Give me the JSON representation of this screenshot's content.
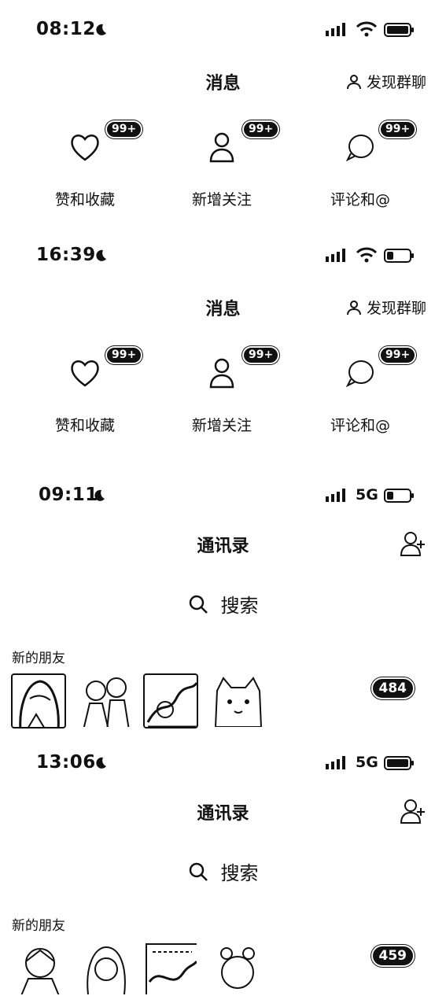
{
  "screens": [
    {
      "time": "08:12",
      "network": "wifi",
      "title": "消息",
      "discover_label": "发现群聊",
      "categories": [
        {
          "label": "赞和收藏",
          "badge": "99+",
          "icon": "heart-icon"
        },
        {
          "label": "新增关注",
          "badge": "99+",
          "icon": "person-icon"
        },
        {
          "label": "评论和@",
          "badge": "99+",
          "icon": "chat-bubble-icon"
        }
      ]
    },
    {
      "time": "16:39",
      "network": "wifi",
      "title": "消息",
      "discover_label": "发现群聊",
      "categories": [
        {
          "label": "赞和收藏",
          "badge": "99+",
          "icon": "heart-icon"
        },
        {
          "label": "新增关注",
          "badge": "99+",
          "icon": "person-icon"
        },
        {
          "label": "评论和@",
          "badge": "99+",
          "icon": "chat-bubble-icon"
        }
      ]
    },
    {
      "time": "09:11",
      "network": "5G",
      "title": "通讯录",
      "search_label": "搜索",
      "section_title": "新的朋友",
      "friend_count": "484"
    },
    {
      "time": "13:06",
      "network": "5G",
      "title": "通讯录",
      "search_label": "搜索",
      "section_title": "新的朋友",
      "friend_count": "459"
    }
  ]
}
